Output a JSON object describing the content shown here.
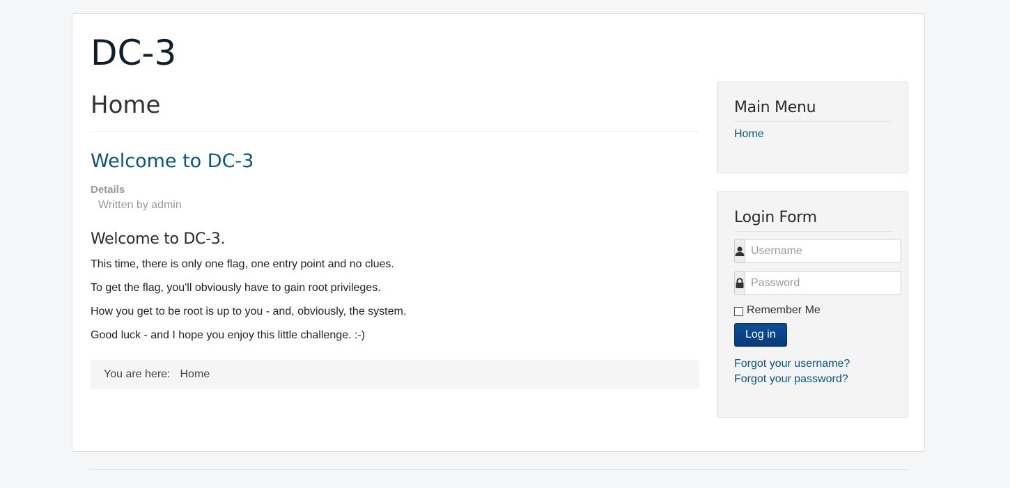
{
  "site": {
    "title": "DC-3"
  },
  "main": {
    "page_heading": "Home",
    "article": {
      "title": "Welcome to DC-3",
      "details_label": "Details",
      "written_by": "Written by admin",
      "heading": "Welcome to DC-3.",
      "paragraphs": [
        "This time, there is only one flag, one entry point and no clues.",
        "To get the flag, you'll obviously have to gain root privileges.",
        "How you get to be root is up to you - and, obviously, the system.",
        "Good luck - and I hope you enjoy this little challenge.  :-)"
      ]
    },
    "breadcrumb": {
      "prefix": "You are here:",
      "current": "Home"
    }
  },
  "sidebar": {
    "main_menu": {
      "title": "Main Menu",
      "items": [
        {
          "label": "Home"
        }
      ]
    },
    "login_form": {
      "title": "Login Form",
      "username_placeholder": "Username",
      "username_value": "",
      "username_icon": "user-icon",
      "password_placeholder": "Password",
      "password_value": "",
      "password_icon": "lock-icon",
      "remember_label": "Remember Me",
      "remember_checked": false,
      "login_label": "Log in",
      "forgot_username": "Forgot your username?",
      "forgot_password": "Forgot your password?"
    }
  },
  "colors": {
    "link": "#08567f",
    "button": "#0b4f9a",
    "page_background": "#f4f6f7"
  }
}
